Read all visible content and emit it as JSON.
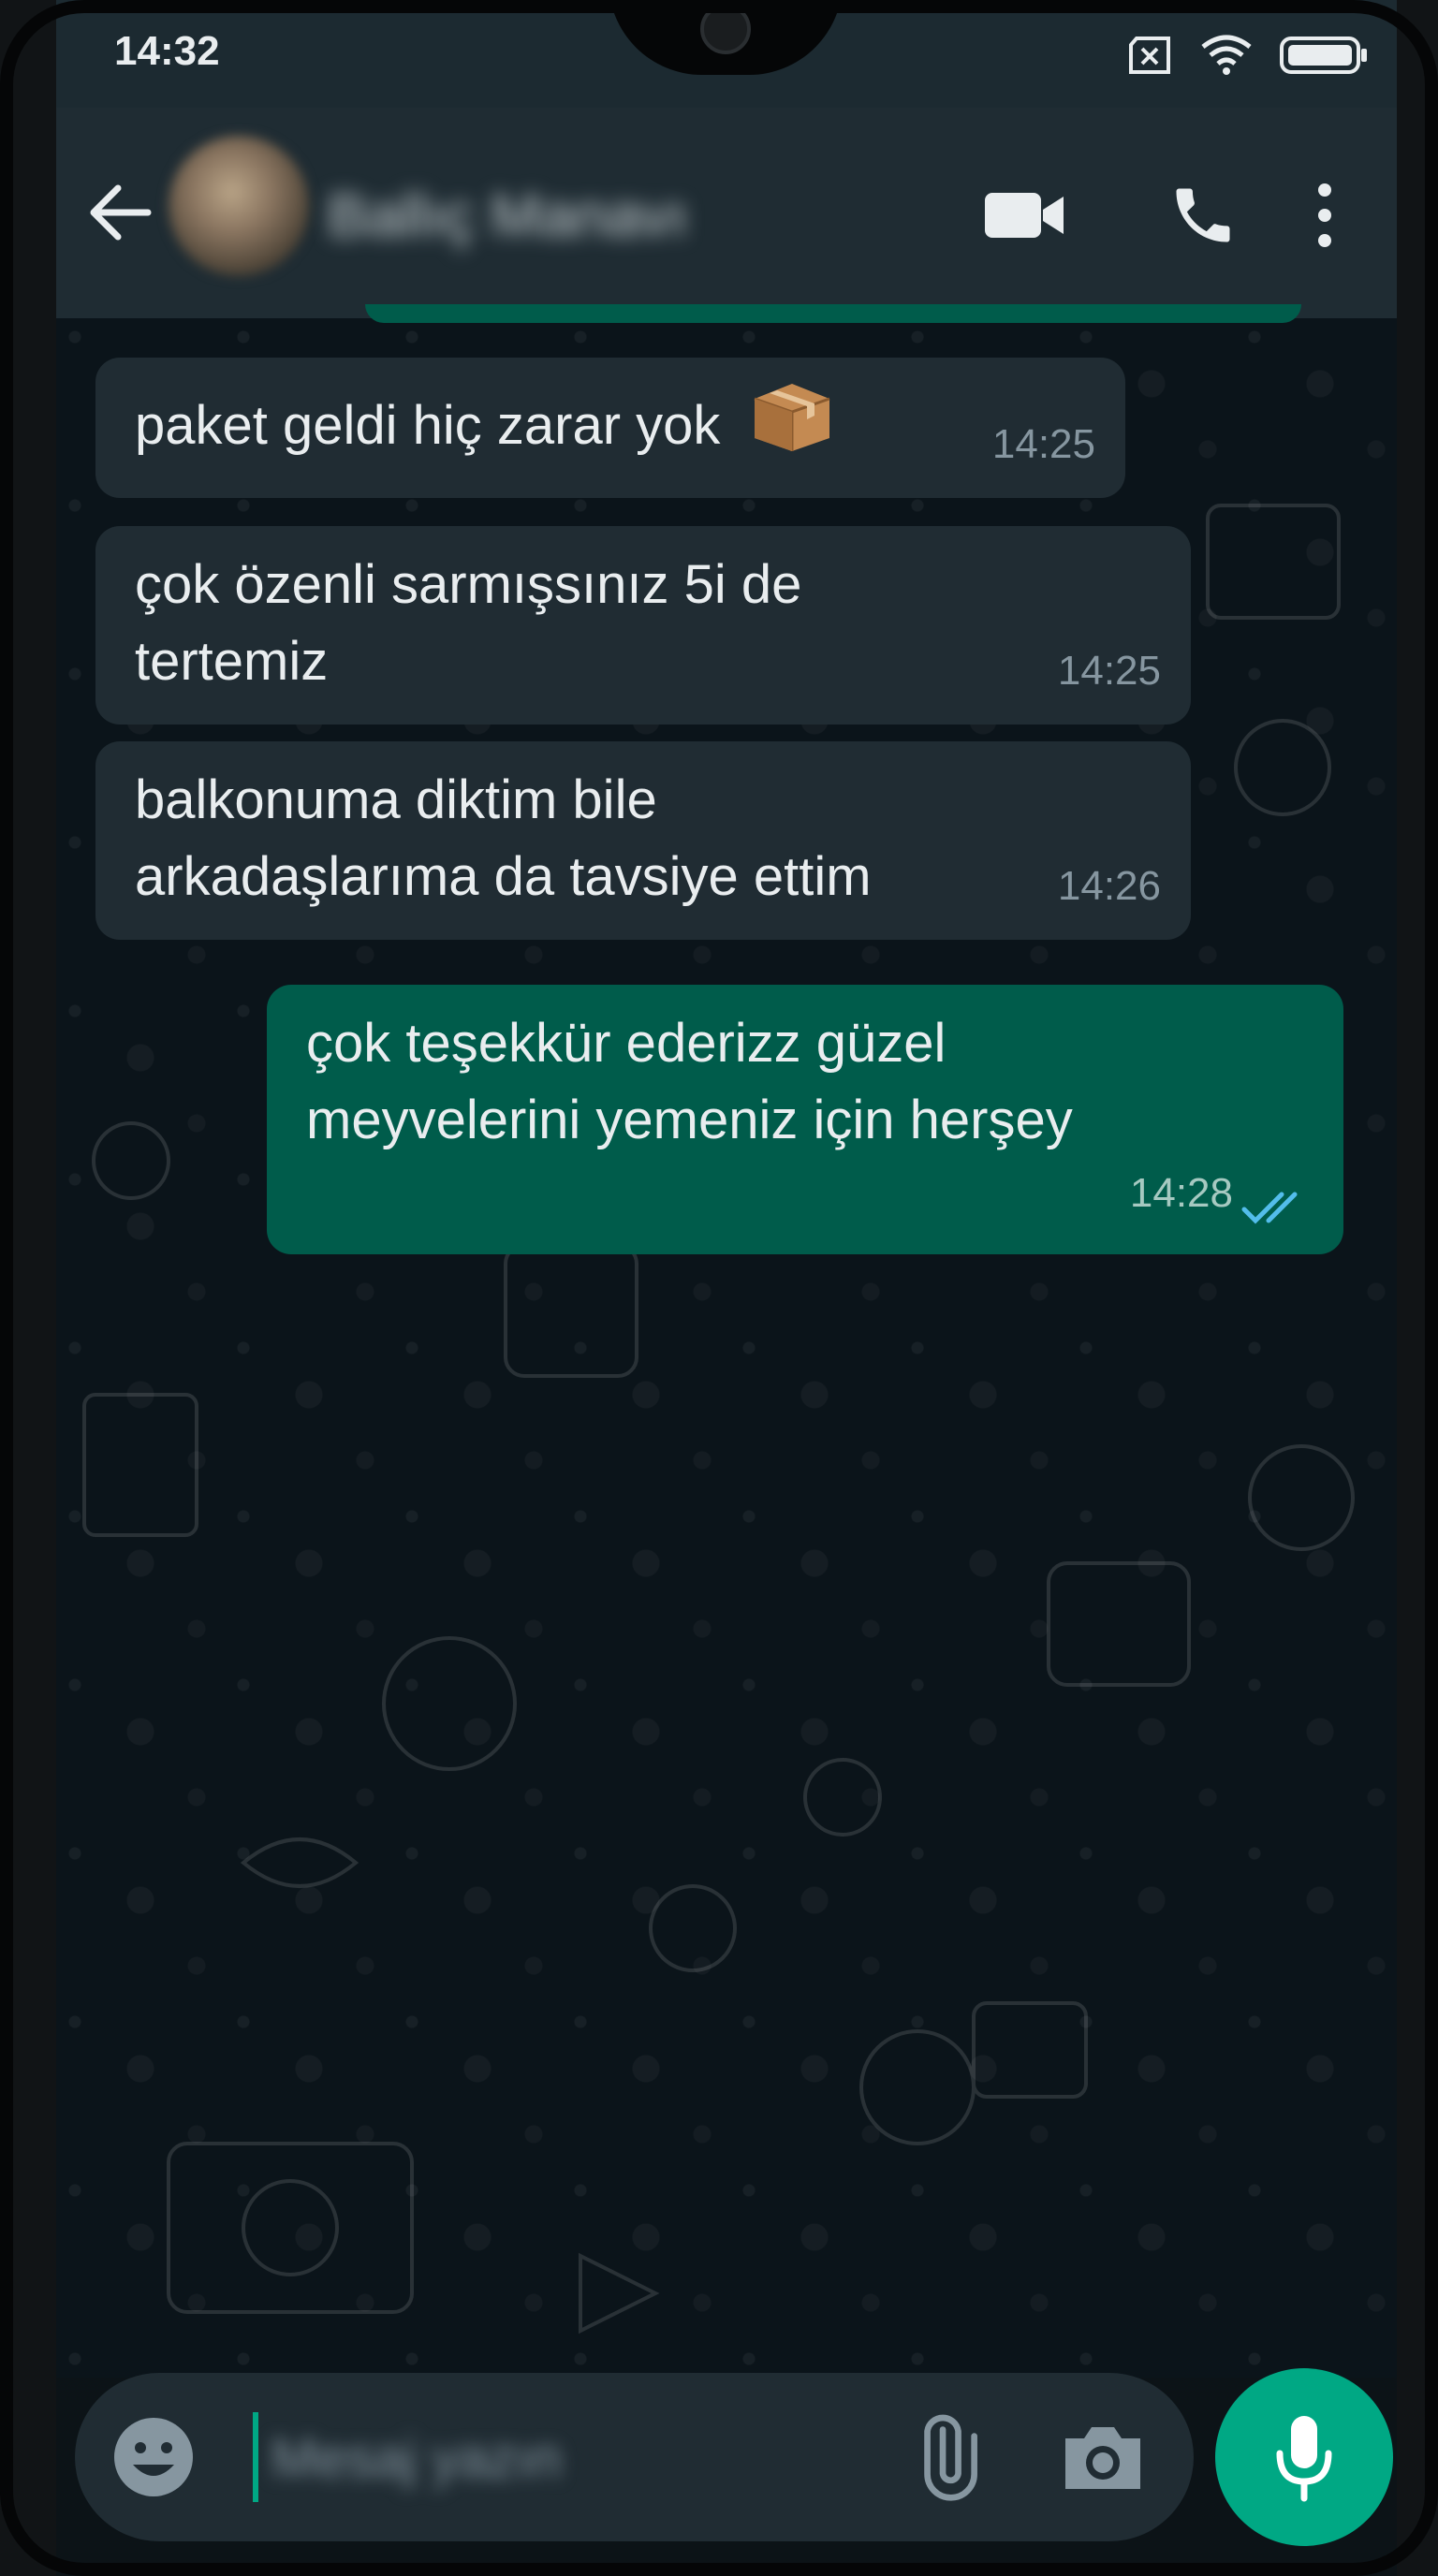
{
  "status_bar": {
    "time": "14:32",
    "icons": [
      "sim-off-icon",
      "wifi-icon",
      "battery-icon"
    ]
  },
  "header": {
    "contact_name": "Ballıç Manavı",
    "icons": [
      "back-arrow-icon",
      "video-call-icon",
      "voice-call-icon",
      "more-options-icon"
    ]
  },
  "messages": [
    {
      "direction": "in",
      "text": "paket geldi hiç zarar yok",
      "emoji": "package-emoji",
      "time": "14:25"
    },
    {
      "direction": "in",
      "text": "çok özenli sarmışsınız 5i de\ntertemiz",
      "time": "14:25"
    },
    {
      "direction": "in",
      "text": "balkonuma diktim bile\narkadaşlarıma da tavsiye ettim",
      "time": "14:26"
    },
    {
      "direction": "out",
      "text": "çok teşekkür ederizz güzel\nmeyvelerini yemeniz için herşey",
      "time": "14:28",
      "status": "read"
    }
  ],
  "input": {
    "placeholder": "Mesaj yazın"
  },
  "colors": {
    "header_bg": "#1f2c33",
    "incoming_bubble": "#202c33",
    "outgoing_bubble": "#005c4b",
    "accent": "#00a884",
    "read_ticks": "#53bdeb"
  }
}
